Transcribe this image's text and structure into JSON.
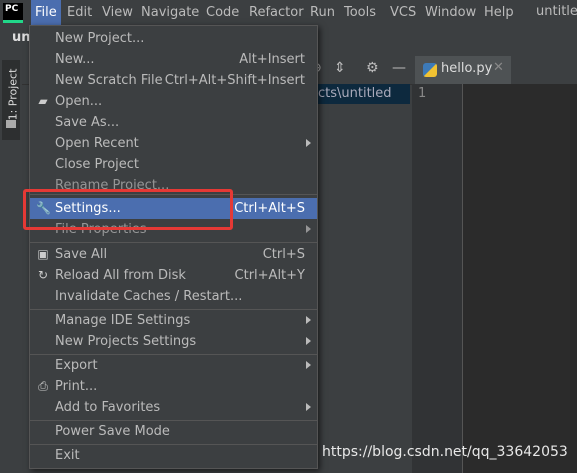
{
  "menubar": {
    "logo": "PC",
    "items": [
      "File",
      "Edit",
      "View",
      "Navigate",
      "Code",
      "Refactor",
      "Run",
      "Tools",
      "VCS",
      "Window",
      "Help"
    ],
    "window_title": "untitled"
  },
  "breadcrumb": "unt",
  "sidebar": {
    "project_tab": "1: Project"
  },
  "tree": {
    "path_text": "cts\\untitled"
  },
  "editor": {
    "tab_label": "hello.py",
    "line_number": "1"
  },
  "file_menu": {
    "items": [
      {
        "label": "New Project...",
        "shortcut": "",
        "icon": "",
        "submenu": false
      },
      {
        "label": "New...",
        "shortcut": "Alt+Insert",
        "icon": "",
        "submenu": false
      },
      {
        "label": "New Scratch File",
        "shortcut": "Ctrl+Alt+Shift+Insert",
        "icon": "",
        "submenu": false
      },
      {
        "label": "Open...",
        "shortcut": "",
        "icon": "folder-open-icon",
        "submenu": false
      },
      {
        "label": "Save As...",
        "shortcut": "",
        "icon": "",
        "submenu": false
      },
      {
        "label": "Open Recent",
        "shortcut": "",
        "icon": "",
        "submenu": true
      },
      {
        "label": "Close Project",
        "shortcut": "",
        "icon": "",
        "submenu": false
      },
      {
        "label": "Rename Project...",
        "shortcut": "",
        "icon": "",
        "submenu": false
      },
      {
        "label": "Settings...",
        "shortcut": "Ctrl+Alt+S",
        "icon": "wrench-icon",
        "submenu": false,
        "selected": true
      },
      {
        "label": "File Properties",
        "shortcut": "",
        "icon": "",
        "submenu": true
      },
      {
        "label": "Save All",
        "shortcut": "Ctrl+S",
        "icon": "save-icon",
        "submenu": false
      },
      {
        "label": "Reload All from Disk",
        "shortcut": "Ctrl+Alt+Y",
        "icon": "reload-icon",
        "submenu": false
      },
      {
        "label": "Invalidate Caches / Restart...",
        "shortcut": "",
        "icon": "",
        "submenu": false
      },
      {
        "label": "Manage IDE Settings",
        "shortcut": "",
        "icon": "",
        "submenu": true
      },
      {
        "label": "New Projects Settings",
        "shortcut": "",
        "icon": "",
        "submenu": true
      },
      {
        "label": "Export",
        "shortcut": "",
        "icon": "",
        "submenu": true
      },
      {
        "label": "Print...",
        "shortcut": "",
        "icon": "print-icon",
        "submenu": false
      },
      {
        "label": "Add to Favorites",
        "shortcut": "",
        "icon": "",
        "submenu": true
      },
      {
        "label": "Power Save Mode",
        "shortcut": "",
        "icon": "",
        "submenu": false
      },
      {
        "label": "Exit",
        "shortcut": "",
        "icon": "",
        "submenu": false
      }
    ]
  },
  "watermark": "https://blog.csdn.net/qq_33642053",
  "colors": {
    "selection": "#4b6eaf",
    "highlight_box": "#e53935",
    "menu_bg": "#3c3f41"
  }
}
